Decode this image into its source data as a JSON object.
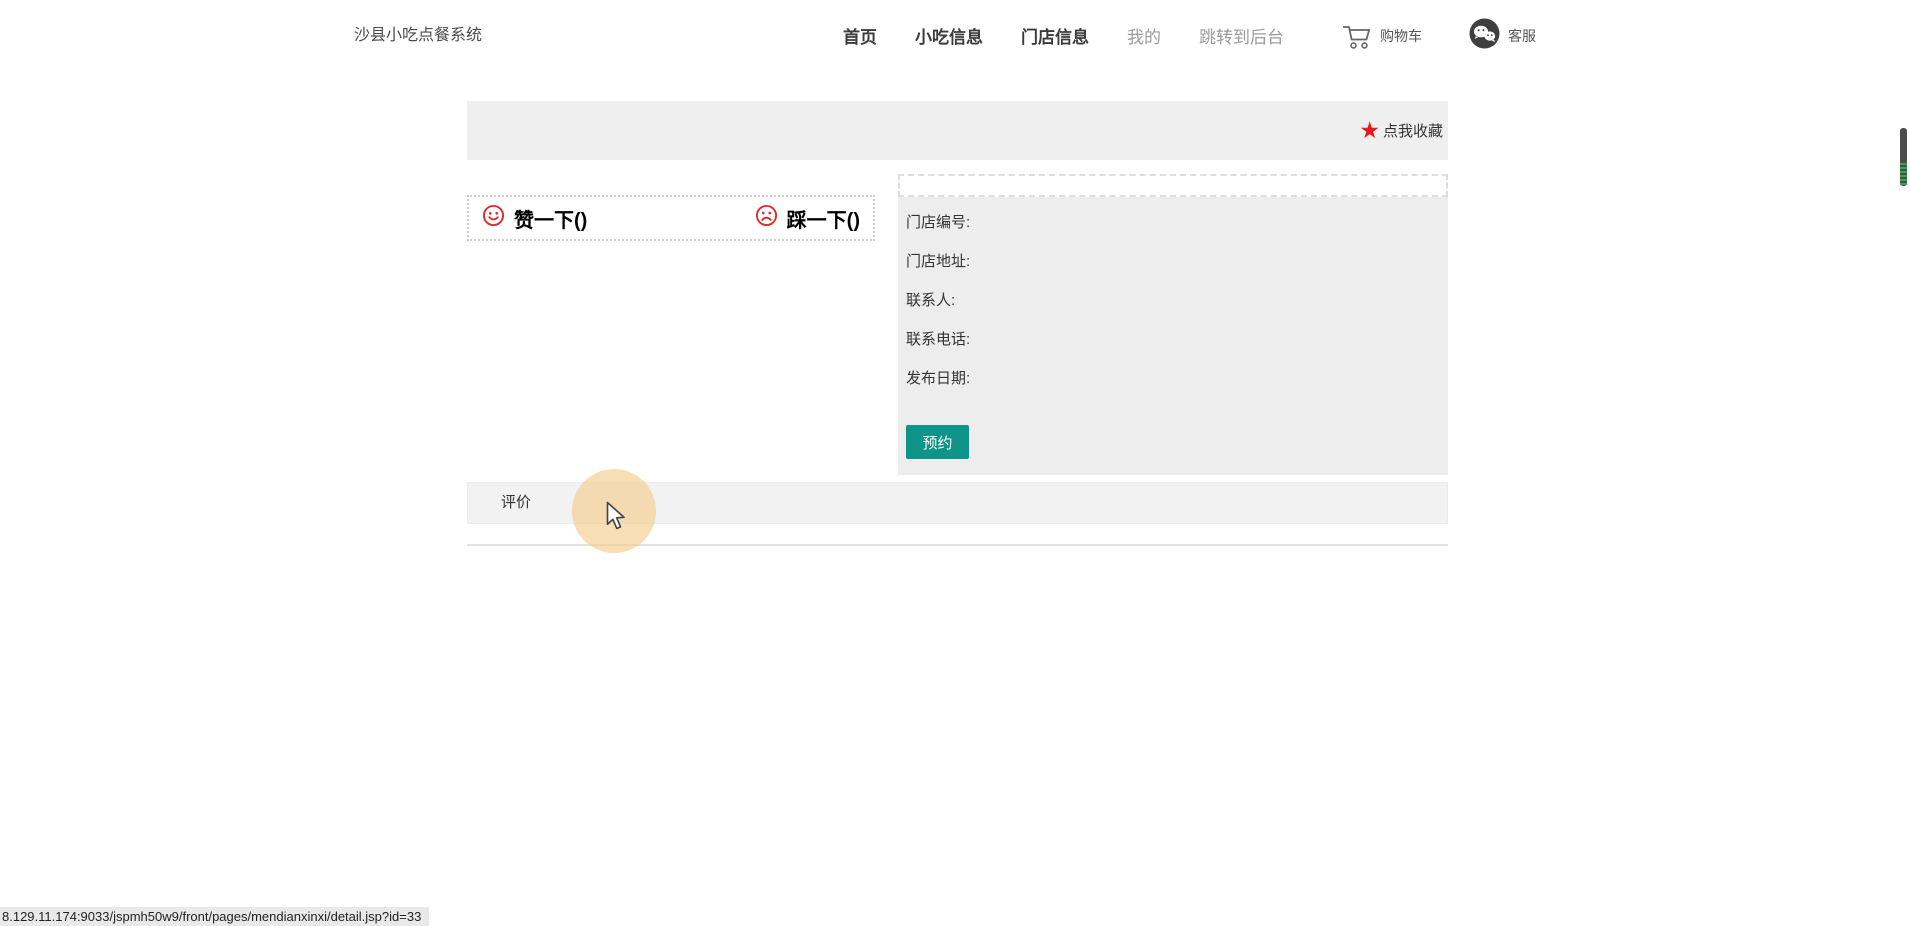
{
  "nav": {
    "brand": "沙县小吃点餐系统",
    "links": [
      {
        "label": "首页",
        "muted": false
      },
      {
        "label": "小吃信息",
        "muted": false
      },
      {
        "label": "门店信息",
        "muted": false
      },
      {
        "label": "我的",
        "muted": true
      },
      {
        "label": "跳转到后台",
        "muted": true
      }
    ],
    "cart_label": "购物车",
    "service_label": "客服"
  },
  "detail": {
    "favorite_label": "点我收藏",
    "like_label": "赞一下()",
    "dislike_label": "踩一下()",
    "fields": [
      {
        "label": "门店编号:",
        "value": ""
      },
      {
        "label": "门店地址:",
        "value": ""
      },
      {
        "label": "联系人:",
        "value": ""
      },
      {
        "label": "联系电话:",
        "value": ""
      },
      {
        "label": "发布日期:",
        "value": ""
      }
    ],
    "reserve_button": "预约"
  },
  "comments": {
    "title": "评价"
  },
  "statusbar": {
    "url": "8.129.11.174:9033/jspmh50w9/front/pages/mendianxinxi/detail.jsp?id=33"
  },
  "icons": {
    "favorite_star": "★",
    "like_face": "smiley-face",
    "dislike_face": "frowny-face",
    "cart": "shopping-cart",
    "service": "wechat-chat-bubbles"
  },
  "colors": {
    "accent": "#0e9488",
    "star_red": "#e8191c",
    "face_red": "#e12b2b",
    "nav_muted": "#9c9c9c",
    "highlight_circle": "#f5cd8c",
    "panel_gray": "#ededed",
    "banner_gray": "#efefef"
  }
}
